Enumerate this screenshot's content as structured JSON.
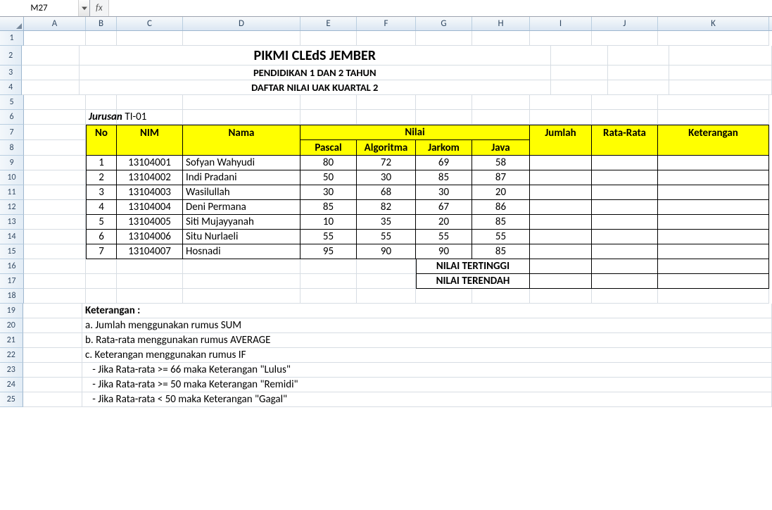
{
  "name_box": "M27",
  "fx_label": "fx",
  "formula_value": "",
  "columns": [
    "A",
    "B",
    "C",
    "D",
    "E",
    "F",
    "G",
    "H",
    "I",
    "J",
    "K"
  ],
  "row_numbers": [
    1,
    2,
    3,
    4,
    5,
    6,
    7,
    8,
    9,
    10,
    11,
    12,
    13,
    14,
    15,
    16,
    17,
    18,
    19,
    20,
    21,
    22,
    23,
    24,
    25
  ],
  "title1": "PIKMI CLEdS JEMBER",
  "title2": "PENDIDIKAN 1 DAN 2 TAHUN",
  "title3": "DAFTAR NILAI UAK KUARTAL 2",
  "jurusan_label": "Jurusan",
  "jurusan_sep": ":",
  "jurusan_value": "TI-01",
  "headers": {
    "no": "No",
    "nim": "NIM",
    "nama": "Nama",
    "nilai": "Nilai",
    "pascal": "Pascal",
    "algoritma": "Algoritma",
    "jarkom": "Jarkom",
    "java": "Java",
    "jumlah": "Jumlah",
    "rata": "Rata-Rata",
    "ket": "Keterangan"
  },
  "rows": [
    {
      "no": 1,
      "nim": "13104001",
      "nama": "Sofyan Wahyudi",
      "pascal": 80,
      "algoritma": 72,
      "jarkom": 69,
      "java": 58
    },
    {
      "no": 2,
      "nim": "13104002",
      "nama": "Indi Pradani",
      "pascal": 50,
      "algoritma": 30,
      "jarkom": 85,
      "java": 87
    },
    {
      "no": 3,
      "nim": "13104003",
      "nama": "Wasilullah",
      "pascal": 30,
      "algoritma": 68,
      "jarkom": 30,
      "java": 20
    },
    {
      "no": 4,
      "nim": "13104004",
      "nama": "Deni Permana",
      "pascal": 85,
      "algoritma": 82,
      "jarkom": 67,
      "java": 86
    },
    {
      "no": 5,
      "nim": "13104005",
      "nama": "Siti Mujayyanah",
      "pascal": 10,
      "algoritma": 35,
      "jarkom": 20,
      "java": 85
    },
    {
      "no": 6,
      "nim": "13104006",
      "nama": "Situ Nurlaeli",
      "pascal": 55,
      "algoritma": 55,
      "jarkom": 55,
      "java": 55
    },
    {
      "no": 7,
      "nim": "13104007",
      "nama": "Hosnadi",
      "pascal": 95,
      "algoritma": 90,
      "jarkom": 90,
      "java": 85
    }
  ],
  "summary": {
    "max": "NILAI TERTINGGI",
    "min": "NILAI TERENDAH"
  },
  "notes_title": "Keterangan :",
  "notes": [
    "a. Jumlah menggunakan rumus SUM",
    "b. Rata-rata menggunakan rumus AVERAGE",
    "c. Keterangan menggunakan rumus IF",
    "   - Jika Rata-rata >= 66 maka Keterangan \"Lulus\"",
    "   - Jika Rata-rata >= 50 maka Keterangan \"Remidi\"",
    "   - Jika Rata-rata < 50 maka Keterangan \"Gagal\""
  ]
}
